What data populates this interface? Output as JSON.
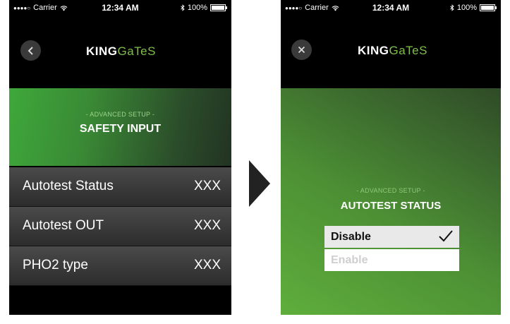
{
  "status_bar": {
    "carrier": "Carrier",
    "signal_dots": "●●●●○",
    "time": "12:34 AM",
    "battery": "100%",
    "battery_level": 1.0
  },
  "logo": {
    "king": "KING",
    "gates": "GaTeS"
  },
  "screen_left": {
    "nav_icon": "back-arrow-icon",
    "section_subtitle": "- ADVANCED SETUP -",
    "section_title": "SAFETY INPUT",
    "items": [
      {
        "label": "Autotest Status",
        "value": "XXX"
      },
      {
        "label": "Autotest OUT",
        "value": "XXX"
      },
      {
        "label": "PHO2 type",
        "value": "XXX"
      }
    ]
  },
  "screen_right": {
    "nav_icon": "close-icon",
    "section_subtitle": "- ADVANCED SETUP -",
    "section_title": "AUTOTEST STATUS",
    "options": [
      {
        "label": "Disable",
        "selected": true
      },
      {
        "label": "Enable",
        "selected": false
      }
    ]
  },
  "colors": {
    "brand_green": "#7fbf4a",
    "background": "#000000"
  }
}
